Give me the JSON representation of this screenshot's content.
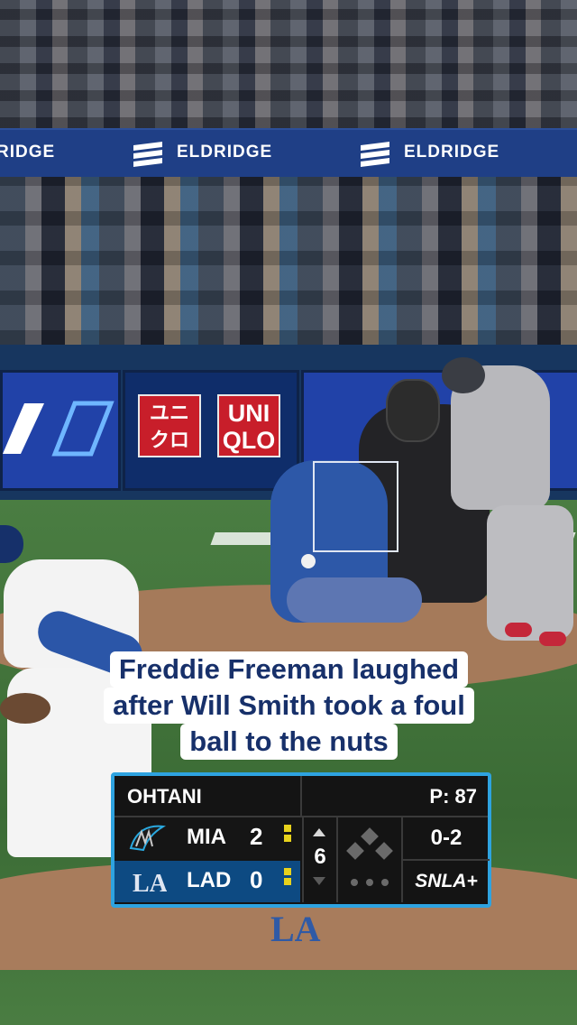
{
  "banner": {
    "sponsor_left": "RIDGE",
    "sponsor_mid": "ELDRIDGE",
    "sponsor_right": "ELDRIDGE"
  },
  "wall": {
    "uniqlo_kanji": "ユニ\nクロ",
    "uniqlo_latin": "UNI\nQLO"
  },
  "caption": {
    "line1": "Freddie Freeman laughed",
    "line2": "after Will Smith took a foul",
    "line3": "ball to the nuts"
  },
  "scorebug": {
    "batter": "OHTANI",
    "pitch_count": "P: 87",
    "border_color": "#2ea3e0",
    "teams": [
      {
        "abbr": "MIA",
        "score": "2",
        "logo": "marlins-logo"
      },
      {
        "abbr": "LAD",
        "score": "0",
        "logo": "dodgers-logo"
      }
    ],
    "inning": "6",
    "count": "0-2",
    "network": "SNLA+"
  },
  "field": {
    "infield_logo": "LA"
  }
}
